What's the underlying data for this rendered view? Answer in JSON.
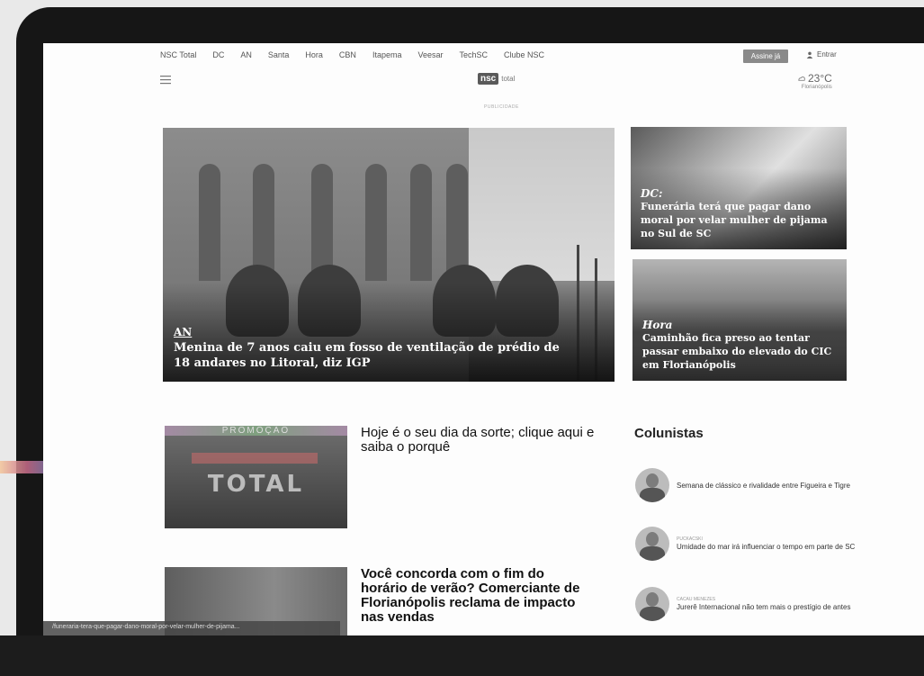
{
  "topnav": {
    "items": [
      "NSC Total",
      "DC",
      "AN",
      "Santa",
      "Hora",
      "CBN",
      "Itapema",
      "Veesar",
      "TechSC",
      "Clube NSC"
    ],
    "subscribe_label": "Assine já",
    "login_label": "Entrar"
  },
  "header": {
    "logo_mark": "nsc",
    "logo_text": "total",
    "temperature": "23°C",
    "city": "Florianópolis",
    "ad_label": "PUBLICIDADE"
  },
  "hero": {
    "tag": "AN",
    "headline": "Menina de 7 anos caiu em fosso de ventilação de prédio de 18 andares no Litoral, diz IGP"
  },
  "side_cards": [
    {
      "tag": "DC:",
      "headline": "Funerária terá que pagar dano moral por velar mulher de pijama no Sul de SC"
    },
    {
      "tag": "Hora",
      "headline": "Caminhão fica preso ao tentar passar embaixo do elevado do CIC em Florianópolis"
    }
  ],
  "articles": [
    {
      "title": "Hoje é o seu dia da sorte; clique aqui e saiba o porquê",
      "thumb_label": "PROMOÇÃO",
      "thumb_big": "TOTAL"
    },
    {
      "title": "Você concorda com o fim do horário de verão? Comerciante de Florianópolis reclama de impacto nas vendas"
    }
  ],
  "columnists": {
    "heading": "Colunistas",
    "items": [
      {
        "name": "",
        "title": "Semana de clássico e rivalidade entre Figueira e Tigre"
      },
      {
        "name": "PUCKACSKI",
        "title": "Umidade do mar irá influenciar o tempo em parte de SC"
      },
      {
        "name": "CACAU MENEZES",
        "title": "Jurerê Internacional não tem mais o prestígio de antes"
      }
    ]
  },
  "status_url": "/funeraria-tera-que-pagar-dano-moral-por-velar-mulher-de-pijama..."
}
